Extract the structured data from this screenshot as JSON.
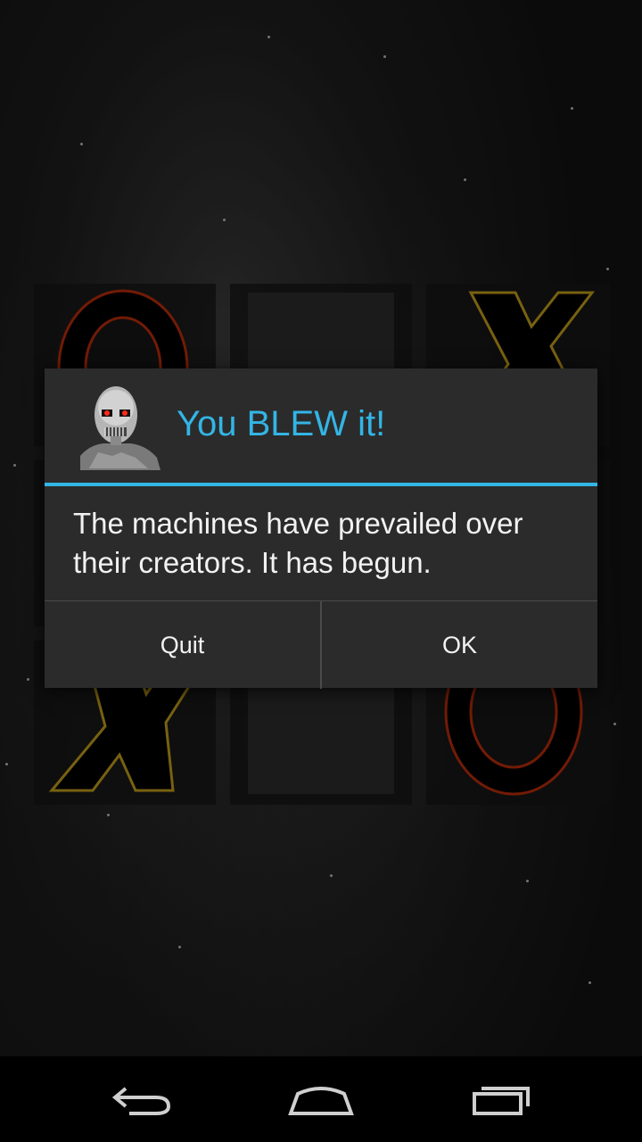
{
  "game": {
    "board": [
      [
        "O",
        "",
        "X"
      ],
      [
        "",
        "",
        ""
      ],
      [
        "X",
        "",
        "O"
      ]
    ]
  },
  "dialog": {
    "title": "You BLEW it!",
    "message": "The machines have prevailed over their creators. It has begun.",
    "icon": "terminator-icon",
    "buttons": {
      "quit": "Quit",
      "ok": "OK"
    }
  },
  "navbar": {
    "icons": [
      "back-icon",
      "home-icon",
      "recent-apps-icon"
    ]
  },
  "colors": {
    "accent": "#33b5e5",
    "x_outline": "#b8961a",
    "o_outline": "#b02a0a",
    "dialog_bg": "#2b2b2b"
  }
}
